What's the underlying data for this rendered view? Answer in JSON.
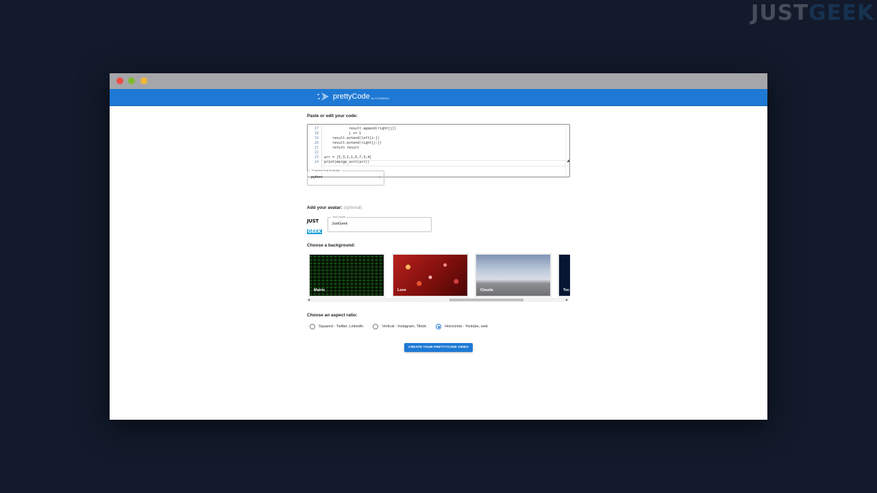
{
  "watermark": {
    "part1": "JUST",
    "part2": "GEEK"
  },
  "app": {
    "name": "prettyCode",
    "sub": "by SCRIBMAX",
    "accent": "#1e79d4"
  },
  "editor": {
    "title": "Paste or edit your code:",
    "lines": [
      {
        "n": "17",
        "code": "            result.append(right[j])"
      },
      {
        "n": "18",
        "code": "            j += 1"
      },
      {
        "n": "19",
        "code": "    result.extend(left[i:])"
      },
      {
        "n": "20",
        "code": "    result.extend(right[j:])"
      },
      {
        "n": "21",
        "code": "    return result"
      },
      {
        "n": "22",
        "code": ""
      },
      {
        "n": "23",
        "code": "arr = [5,3,1,1,6,7,3,4]"
      },
      {
        "n": "24",
        "code": "print(merge_sort(arr))"
      }
    ]
  },
  "language": {
    "legend": "Programming language",
    "value": "python",
    "caret": "▾"
  },
  "avatar": {
    "title": "Add your avatar:",
    "optional": "(optional)",
    "logo_line1": "JUST",
    "logo_line2": "GEEK",
    "name_legend": "Your name",
    "name_value": "JustGeek"
  },
  "backgrounds": {
    "title": "Choose a background:",
    "items": [
      {
        "label": "Matrix"
      },
      {
        "label": "Love"
      },
      {
        "label": "Clouds"
      },
      {
        "label": "Tec"
      }
    ]
  },
  "ratio": {
    "title": "Choose an aspect ratio:",
    "options": [
      {
        "label": "Squared - Twitter, LinkedIn",
        "checked": false
      },
      {
        "label": "Vertical - Instagram, Tiktok",
        "checked": false
      },
      {
        "label": "Horizontal - Youtube, web",
        "checked": true
      }
    ]
  },
  "create_button": "CREATE YOUR PRETTYCODE VIDEO"
}
